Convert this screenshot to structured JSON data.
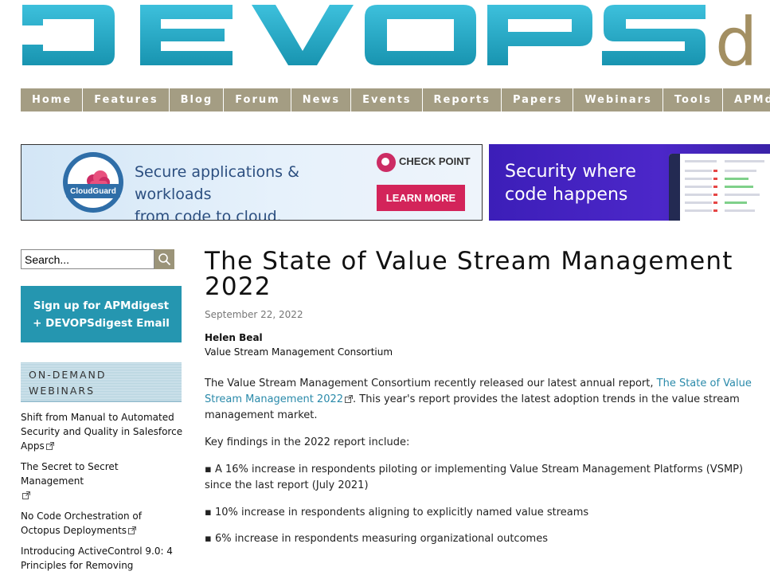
{
  "logo": {
    "text_main": "DEVOPS",
    "text_suffix": "d",
    "main_color": "#1aa4c2",
    "suffix_color": "#a38f62"
  },
  "nav": {
    "bg_color": "#a49d83",
    "items": [
      "Home",
      "Features",
      "Blog",
      "Forum",
      "News",
      "Events",
      "Reports",
      "Papers",
      "Webinars",
      "Tools",
      "APMdi"
    ]
  },
  "ads": {
    "checkpoint": {
      "badge": "CloudGuard",
      "headline_line1": "Secure applications & workloads",
      "headline_line2": "from code to cloud.",
      "brand": "CHECK POINT",
      "cta": "LEARN MORE"
    },
    "security": {
      "headline_line1": "Security where",
      "headline_line2": "code happens"
    }
  },
  "sidebar": {
    "search_value": "Search...",
    "signup_line1": "Sign up for APMdigest",
    "signup_line2": "+ DEVOPSdigest Email",
    "ondemand_line1": "ON-DEMAND",
    "ondemand_line2": "WEBINARS",
    "webinars": [
      {
        "title": "Shift from Manual to Automated Security and Quality in Salesforce Apps"
      },
      {
        "title": "The Secret to Secret Management"
      },
      {
        "title": "No Code Orchestration of Octopus Deployments"
      },
      {
        "title": "Introducing ActiveControl 9.0: 4 Principles for Removing"
      }
    ]
  },
  "article": {
    "title": "The State of Value Stream Management 2022",
    "date": "September 22, 2022",
    "author": "Helen Beal",
    "organization": "Value Stream Management Consortium",
    "p1_before": "The Value Stream Management Consortium recently released our latest annual report, ",
    "p1_link": "The State of Value Stream Management 2022",
    "p1_after": ". This year's report provides the latest adoption trends in the value stream management market.",
    "p2": "Key findings in the 2022 report include:",
    "bullets": [
      "▪ A 16% increase in respondents piloting or implementing Value Stream Management Platforms (VSMP) since the last report (July 2021)",
      "▪ 10% increase in respondents aligning to explicitly named value streams",
      "▪ 6% increase in respondents measuring organizational outcomes"
    ],
    "link_color": "#2a8aaa"
  }
}
